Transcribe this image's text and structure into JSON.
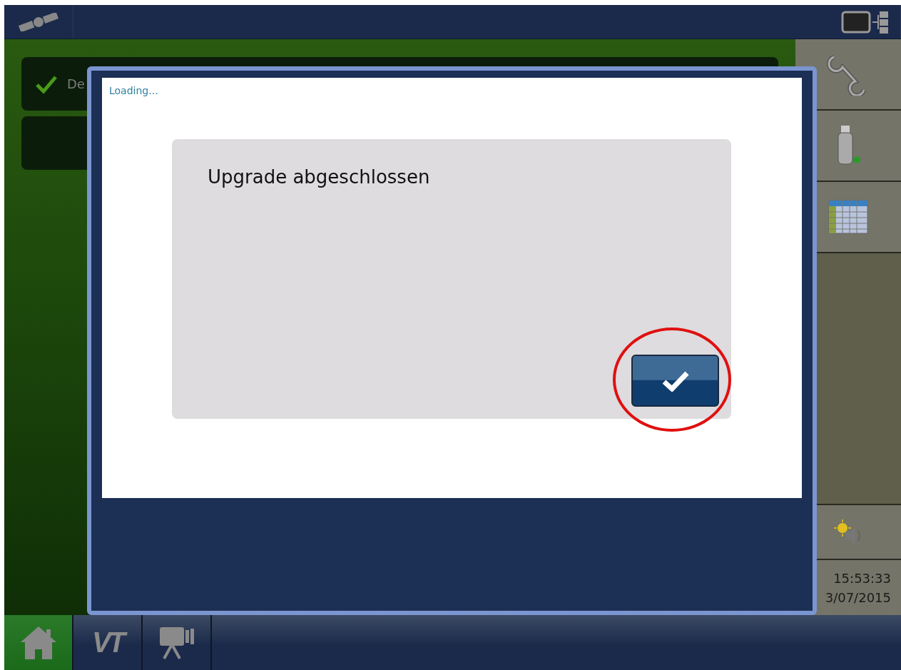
{
  "main_cards": [
    {
      "label": "De",
      "checked": true
    },
    {
      "checked": false
    }
  ],
  "side_buttons": [
    {
      "kind": "wrench"
    },
    {
      "kind": "usb"
    },
    {
      "kind": "table"
    }
  ],
  "status": {
    "time": "15:53:33",
    "date": "3/07/2015"
  },
  "bottom_tabs": [
    {
      "kind": "home",
      "selected": true
    },
    {
      "kind": "vt",
      "label": "VT",
      "selected": false
    },
    {
      "kind": "camera",
      "selected": false
    }
  ],
  "dialog": {
    "status": "Loading...",
    "message": "Upgrade abgeschlossen",
    "highlighted": true
  }
}
